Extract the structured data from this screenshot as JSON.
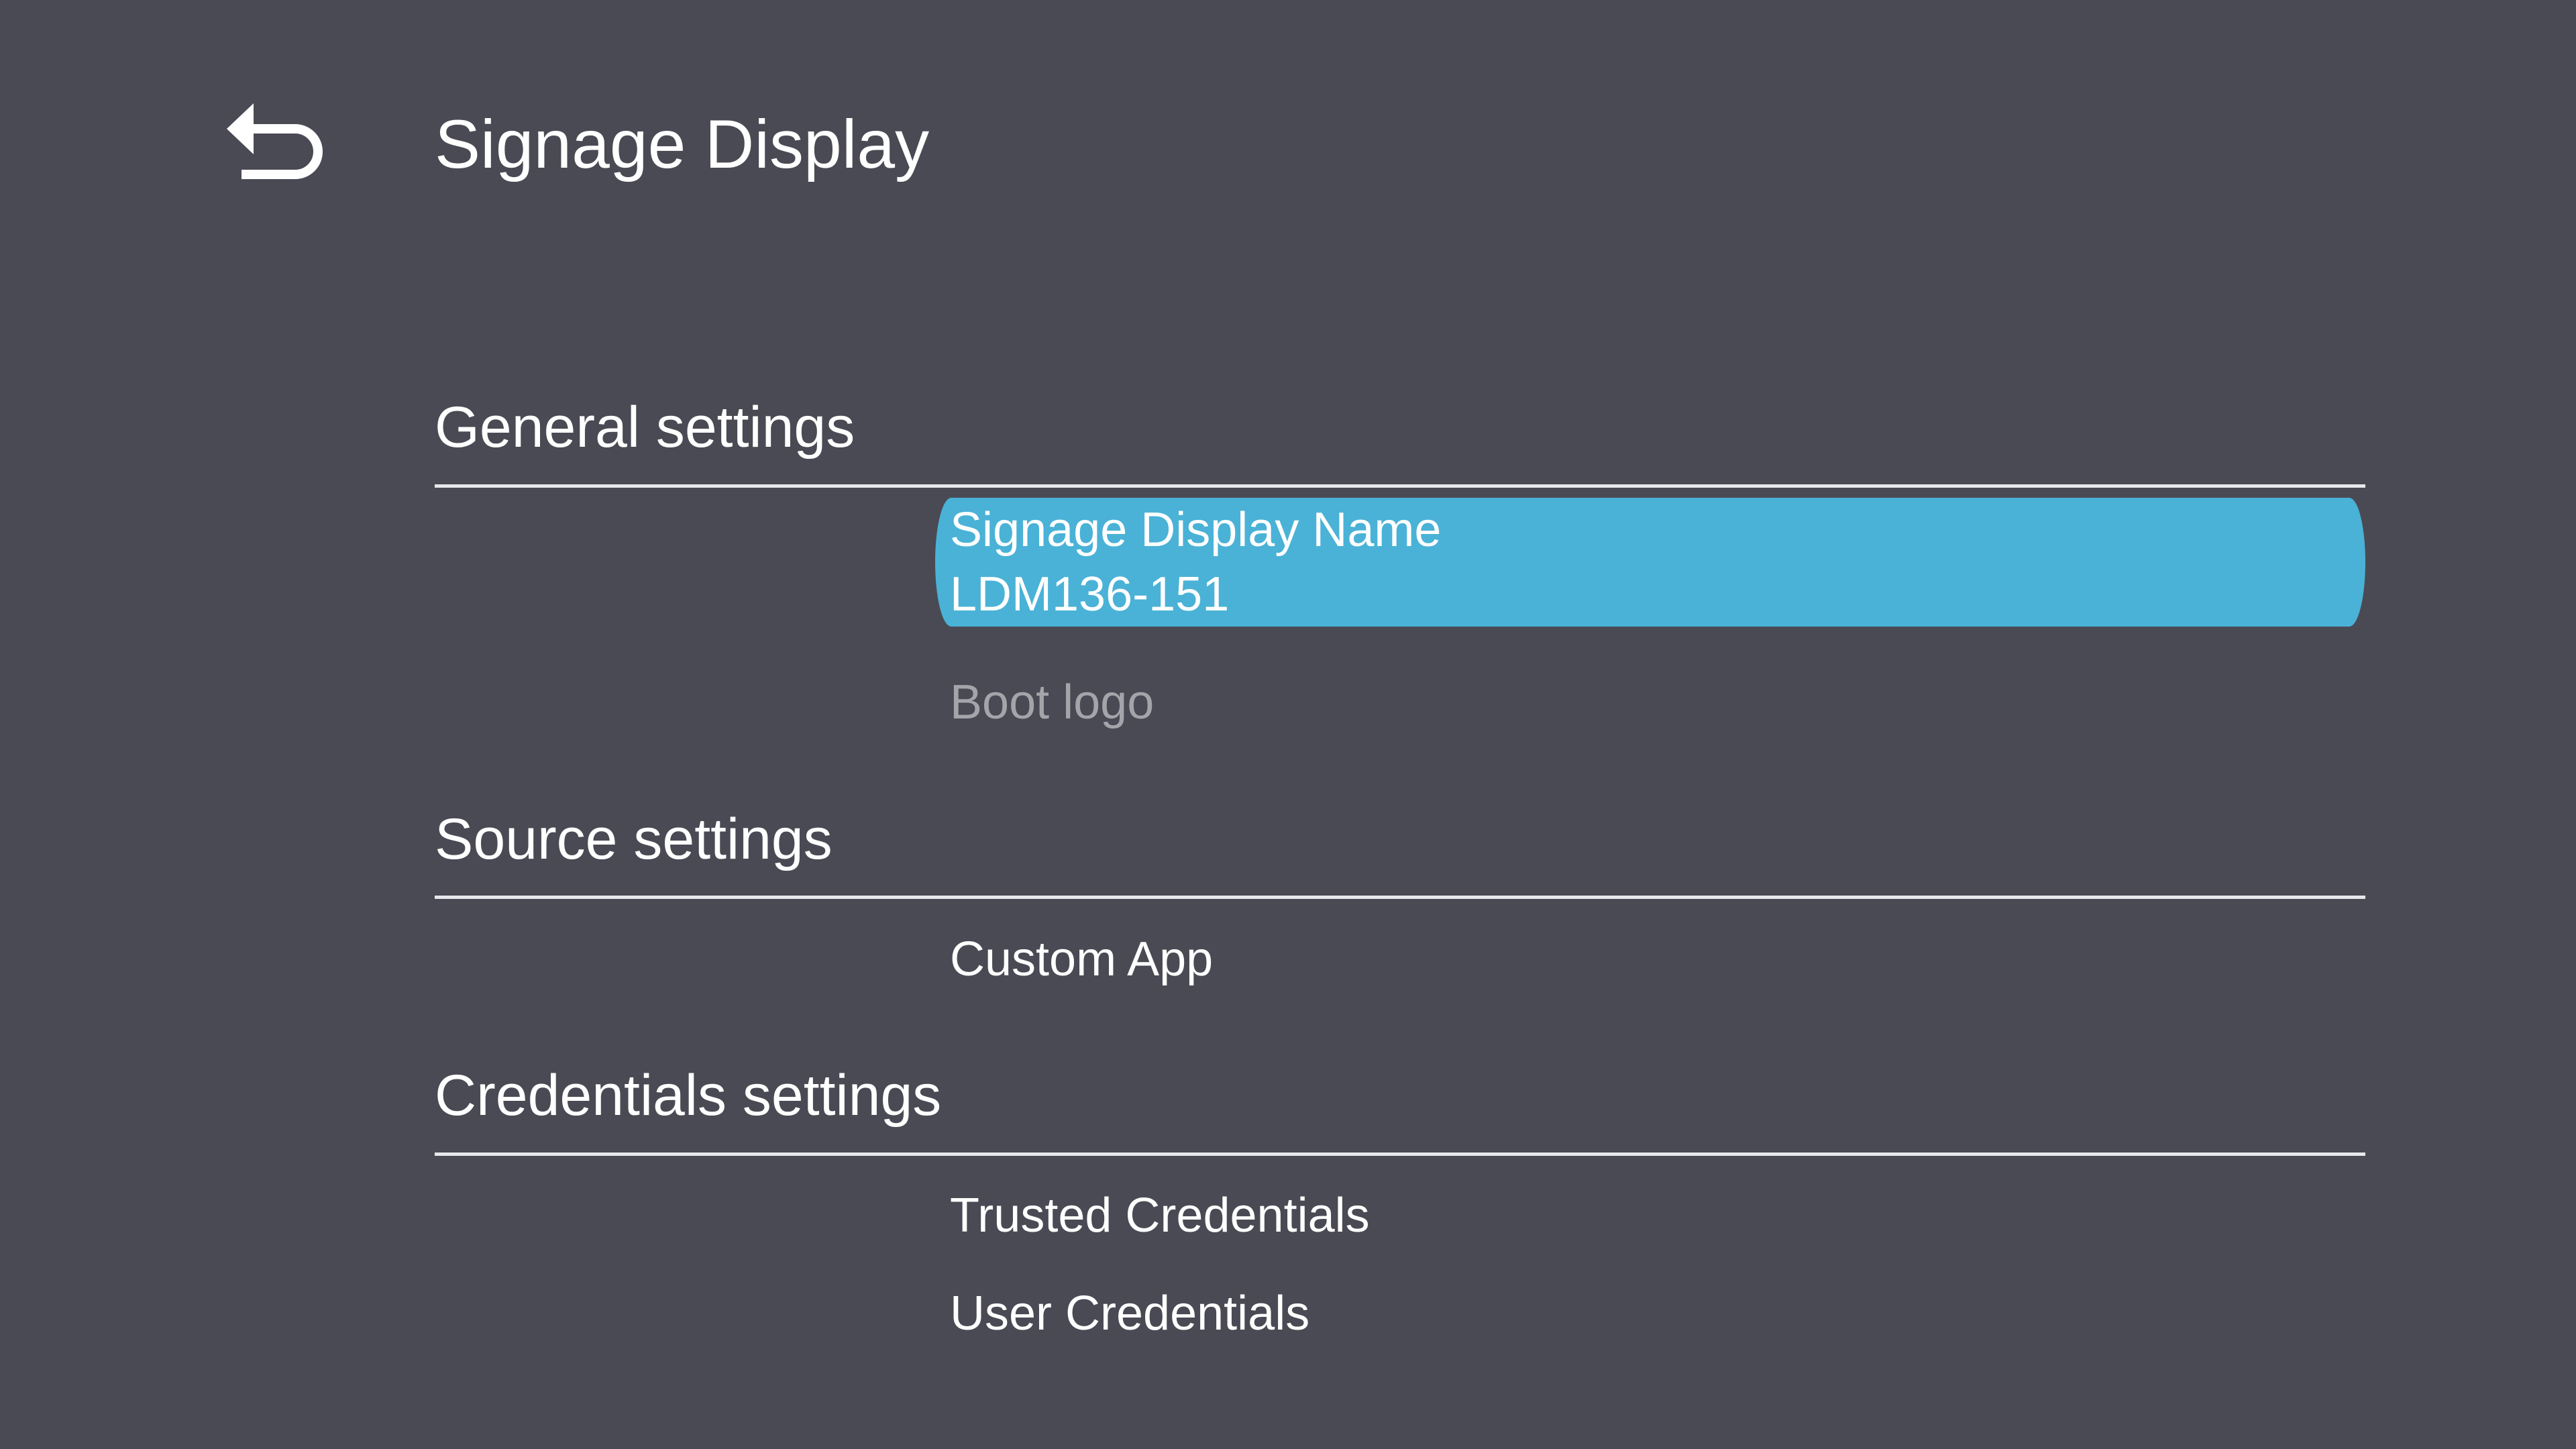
{
  "header": {
    "title": "Signage Display",
    "back_icon": "back-arrow-icon"
  },
  "sections": [
    {
      "title": "General settings",
      "items": [
        {
          "label": "Signage Display Name",
          "value": "LDM136-151",
          "selected": true
        },
        {
          "label": "Boot logo",
          "disabled": true
        }
      ]
    },
    {
      "title": "Source settings",
      "items": [
        {
          "label": "Custom App"
        }
      ]
    },
    {
      "title": "Credentials settings",
      "items": [
        {
          "label": "Trusted Credentials"
        },
        {
          "label": "User Credentials"
        }
      ]
    }
  ],
  "colors": {
    "background": "#4a4a54",
    "selection": "#4ab2d6",
    "disabled_text": "#a4a4aa"
  }
}
